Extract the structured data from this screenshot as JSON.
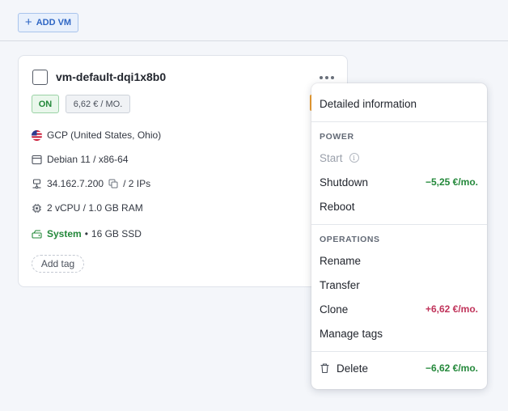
{
  "toolbar": {
    "add_vm_icon": "plus-icon",
    "add_vm_label": "ADD VM"
  },
  "vm": {
    "name": "vm-default-dqi1x8b0",
    "status": "ON",
    "price": "6,62 € / MO.",
    "location": "GCP (United States, Ohio)",
    "location_icon": "us-flag-icon",
    "os": "Debian 11 / x86-64",
    "ip": "34.162.7.200",
    "ip_count": "/ 2 IPs",
    "resources": "2 vCPU / 1.0 GB RAM",
    "disk_type": "System",
    "disk_sep": "•",
    "disk_size": "16 GB SSD",
    "add_tag_label": "Add tag"
  },
  "menu": {
    "detailed_info": "Detailed information",
    "power_header": "POWER",
    "start": "Start",
    "shutdown": "Shutdown",
    "shutdown_price": "−5,25 €/mo.",
    "reboot": "Reboot",
    "operations_header": "OPERATIONS",
    "rename": "Rename",
    "transfer": "Transfer",
    "clone": "Clone",
    "clone_price": "+6,62 €/mo.",
    "manage_tags": "Manage tags",
    "delete": "Delete",
    "delete_price": "−6,62 €/mo."
  },
  "colors": {
    "accent": "#2e66c4",
    "success": "#23883a",
    "danger": "#c0335a",
    "warning": "#f0a030"
  }
}
